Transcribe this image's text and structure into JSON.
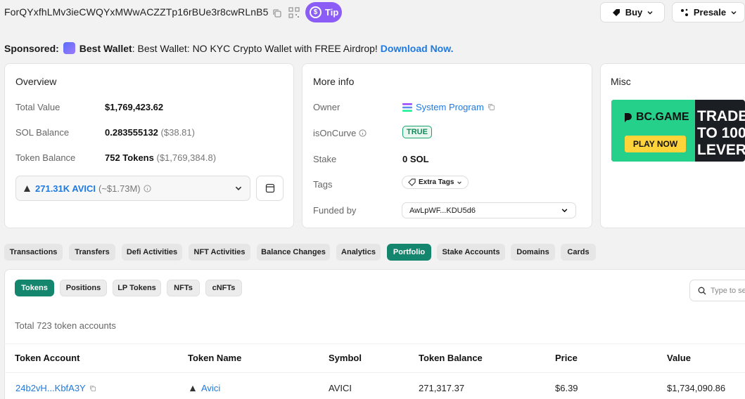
{
  "header": {
    "address": "ForQYxfhLMv3ieCWQYxMWwACZZTp16rBUe3r8cwRLnB5",
    "tip_label": "Tip",
    "buy_label": "Buy",
    "presale_label": "Presale"
  },
  "sponsored": {
    "prefix": "Sponsored:",
    "name": "Best Wallet",
    "text": ": Best Wallet: NO KYC Crypto Wallet with FREE Airdrop!",
    "link": "Download Now."
  },
  "overview": {
    "title": "Overview",
    "rows": [
      {
        "label": "Total Value",
        "value": "$1,769,423.62",
        "extra": ""
      },
      {
        "label": "SOL Balance",
        "value": "0.283555132",
        "extra": "($38.81)"
      },
      {
        "label": "Token Balance",
        "value": "752 Tokens",
        "extra": "($1,769,384.8)"
      }
    ],
    "token_select": {
      "value": "271.31K AVICI",
      "extra": "(~$1.73M)"
    }
  },
  "more_info": {
    "title": "More info",
    "owner_label": "Owner",
    "owner_value": "System Program",
    "oncurve_label": "isOnCurve",
    "oncurve_value": "TRUE",
    "stake_label": "Stake",
    "stake_value": "0 SOL",
    "tags_label": "Tags",
    "tags_value": "Extra Tags",
    "funded_label": "Funded by",
    "funded_value": "AwLpWF...KDU5d6"
  },
  "misc": {
    "title": "Misc",
    "ad": {
      "brand": "BC.GAME",
      "cta": "PLAY NOW",
      "headline_1": "TRADE",
      "headline_2": "TO 100",
      "headline_3": "LEVER"
    }
  },
  "tabs": [
    "Transactions",
    "Transfers",
    "Defi Activities",
    "NFT Activities",
    "Balance Changes",
    "Analytics",
    "Portfolio",
    "Stake Accounts",
    "Domains",
    "Cards"
  ],
  "subtabs": [
    "Tokens",
    "Positions",
    "LP Tokens",
    "NFTs",
    "cNFTs"
  ],
  "search": {
    "placeholder": "Type to se"
  },
  "summary": "Total 723 token accounts",
  "table": {
    "headers": [
      "Token Account",
      "Token Name",
      "Symbol",
      "Token Balance",
      "Price",
      "Value"
    ],
    "rows": [
      {
        "account": "24b2vH...KbfA3Y",
        "name": "Avici",
        "symbol": "AVICI",
        "balance": "271,317.37",
        "price": "$6.39",
        "value": "$1,734,090.86"
      }
    ]
  },
  "colors": {
    "accent_green": "#14866d",
    "link_blue": "#1f7ae0",
    "tip_purple": "#8b5cf6"
  }
}
